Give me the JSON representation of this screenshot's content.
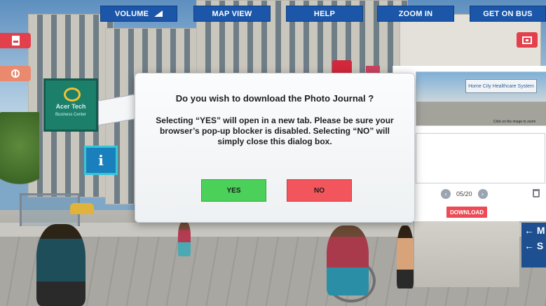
{
  "nav": {
    "volume_label": "VOLUME",
    "map_view_label": "MAP VIEW",
    "help_label": "HELP",
    "zoom_in_label": "ZOOM IN",
    "get_on_bus_label": "GET ON BUS"
  },
  "scene": {
    "acer_sign_title": "Acer Tech",
    "acer_sign_subtitle": "Business Center",
    "info_symbol": "i",
    "direction_sign_text": "← M\n← S"
  },
  "journal": {
    "photo_sign_text": "Home City Healthcare System",
    "photo_hint": "Click on the image to zoom",
    "page_indicator": "05/20",
    "prev_symbol": "‹",
    "next_symbol": "›",
    "download_label": "DOWNLOAD"
  },
  "dialog": {
    "title": "Do you wish to download the Photo Journal ?",
    "message": "Selecting “YES” will open in a new tab.  Please be sure your browser’s pop-up blocker is disabled. Selecting “NO” will simply close this dialog box.",
    "yes_label": "YES",
    "no_label": "NO"
  },
  "colors": {
    "nav_blue": "#1b56a9",
    "side_red": "#ec4a55",
    "yes_green": "#4bd05a",
    "no_red": "#f2555b"
  },
  "icons": [
    "pdf-icon",
    "globe-icon",
    "screen-share-icon",
    "volume-indicator-icon",
    "info-icon",
    "trash-icon",
    "chevron-left-icon",
    "chevron-right-icon"
  ]
}
